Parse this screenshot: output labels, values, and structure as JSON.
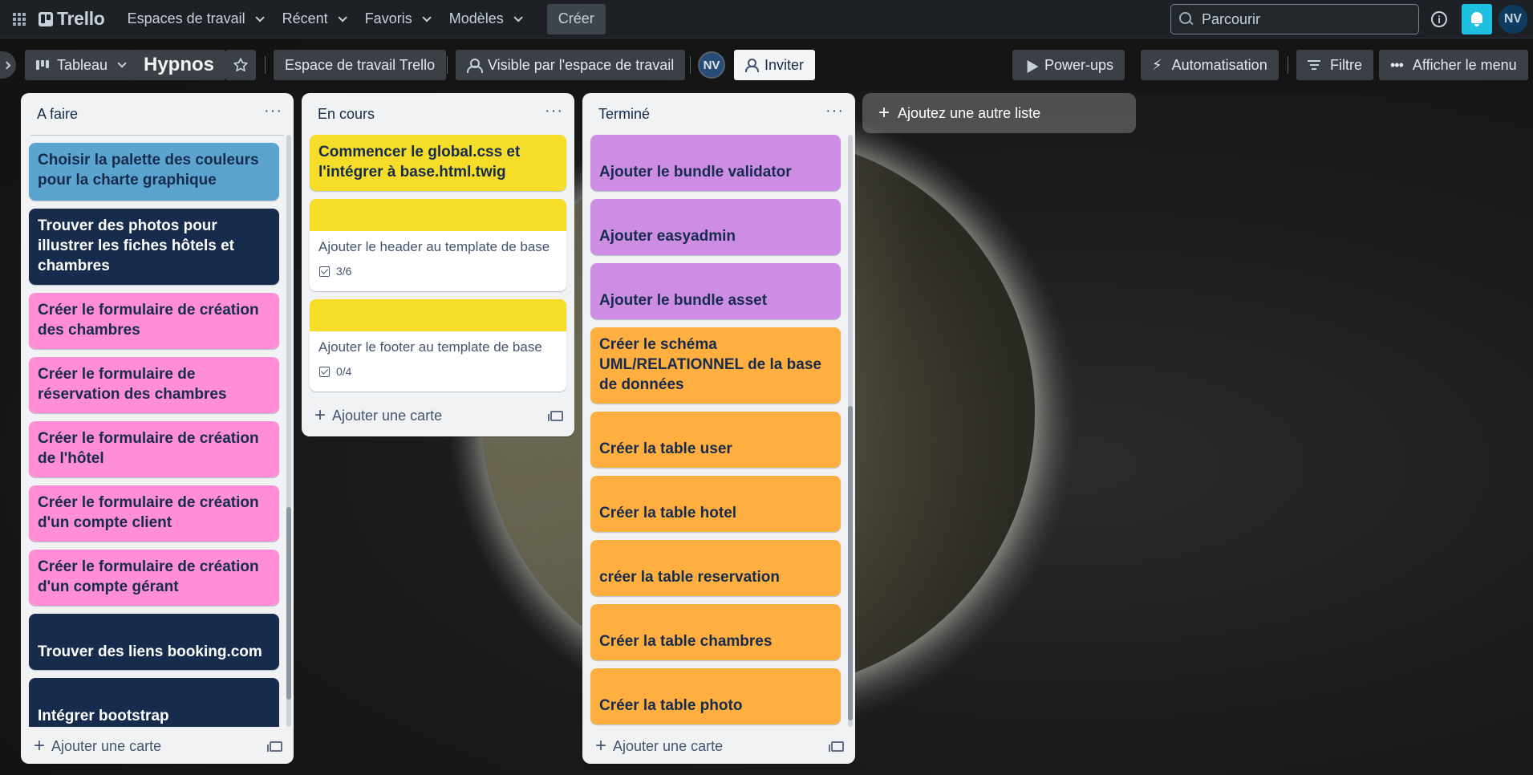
{
  "topnav": {
    "logo": "Trello",
    "items": [
      {
        "label": "Espaces de travail"
      },
      {
        "label": "Récent"
      },
      {
        "label": "Favoris"
      },
      {
        "label": "Modèles"
      }
    ],
    "create_label": "Créer",
    "search_placeholder": "Parcourir",
    "avatar_initials": "NV"
  },
  "board": {
    "view_label": "Tableau",
    "title": "Hypnos",
    "workspace_label": "Espace de travail Trello",
    "visibility_label": "Visible par l'espace de travail",
    "member_initials": "NV",
    "invite_label": "Inviter",
    "powerups_label": "Power-ups",
    "automation_label": "Automatisation",
    "filter_label": "Filtre",
    "menu_label": "Afficher le menu"
  },
  "colors": {
    "blue": "#5ba4cf",
    "navy": "#172b4d",
    "pink": "#ff8ed4",
    "yellow": "#f5dd29",
    "purple": "#cd8de5",
    "orange": "#ffaf3f"
  },
  "lists": [
    {
      "title": "A faire",
      "add_label": "Ajouter une carte",
      "cards": [
        {
          "title": "Choisir la palette des couleurs pour la charte graphique",
          "color": "blue"
        },
        {
          "title": "Trouver des photos pour illustrer les fiches hôtels et chambres",
          "color": "navy"
        },
        {
          "title": "Créer le formulaire de création des chambres",
          "color": "pink"
        },
        {
          "title": "Créer le formulaire de réservation des chambres",
          "color": "pink"
        },
        {
          "title": "Créer le formulaire de création de l'hôtel",
          "color": "pink"
        },
        {
          "title": "Créer le formulaire de création d'un compte client",
          "color": "pink"
        },
        {
          "title": "Créer le formulaire de création d'un compte gérant",
          "color": "pink"
        },
        {
          "title": "Trouver des liens booking.com",
          "color": "navy"
        },
        {
          "title": "Intégrer bootstrap",
          "color": "navy"
        }
      ]
    },
    {
      "title": "En cours",
      "add_label": "Ajouter une carte",
      "cards": [
        {
          "title": "Commencer le global.css et l'intégrer à base.html.twig",
          "color": "yellow"
        },
        {
          "title": "Ajouter le header au template de base",
          "checklist": "3/6",
          "cover": "yellow"
        },
        {
          "title": "Ajouter le footer au template de base",
          "checklist": "0/4",
          "cover": "yellow"
        }
      ]
    },
    {
      "title": "Terminé",
      "add_label": "Ajouter une carte",
      "cards": [
        {
          "title": "Ajouter le bundle validator",
          "color": "purple"
        },
        {
          "title": "Ajouter easyadmin",
          "color": "purple"
        },
        {
          "title": "Ajouter le bundle asset",
          "color": "purple"
        },
        {
          "title": "Créer le schéma UML/RELATIONNEL de la base de données",
          "color": "orange"
        },
        {
          "title": "Créer la table user",
          "color": "orange"
        },
        {
          "title": "Créer la table hotel",
          "color": "orange"
        },
        {
          "title": "créer la table reservation",
          "color": "orange"
        },
        {
          "title": "Créer la table chambres",
          "color": "orange"
        },
        {
          "title": "Créer la table photo",
          "color": "orange"
        }
      ]
    }
  ],
  "add_list_label": "Ajoutez une autre liste"
}
